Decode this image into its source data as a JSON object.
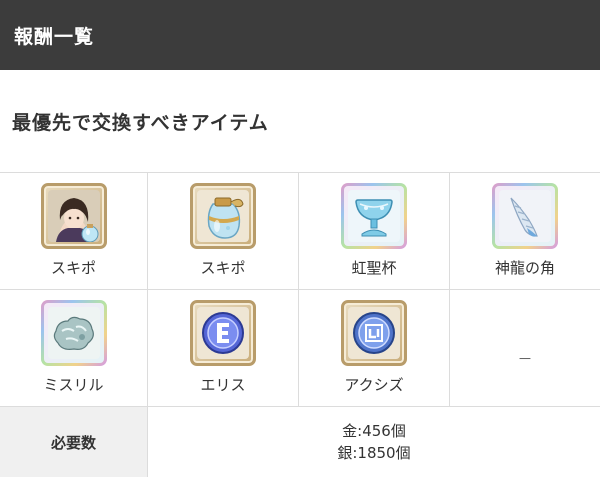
{
  "header": {
    "title": "報酬一覧"
  },
  "section": {
    "title": "最優先で交換すべきアイテム"
  },
  "items": [
    {
      "label": "スキポ",
      "icon": "character-portrait-skill-potion-icon",
      "frame": "bronze"
    },
    {
      "label": "スキポ",
      "icon": "skill-potion-icon",
      "frame": "bronze"
    },
    {
      "label": "虹聖杯",
      "icon": "rainbow-holy-grail-icon",
      "frame": "rainbow"
    },
    {
      "label": "神龍の角",
      "icon": "dragon-horn-icon",
      "frame": "rainbow"
    },
    {
      "label": "ミスリル",
      "icon": "mithril-ore-icon",
      "frame": "rainbow"
    },
    {
      "label": "エリス",
      "icon": "eris-coin-icon",
      "frame": "bronze"
    },
    {
      "label": "アクシズ",
      "icon": "axis-coin-icon",
      "frame": "bronze"
    },
    {
      "label": "－",
      "icon": "",
      "frame": ""
    }
  ],
  "required": {
    "label": "必要数",
    "gold": "金:456個",
    "silver": "銀:1850個"
  },
  "colors": {
    "header_bg": "#3c3c3c",
    "grid_border": "#dcdcdc",
    "label_bg": "#f0f0f0"
  }
}
